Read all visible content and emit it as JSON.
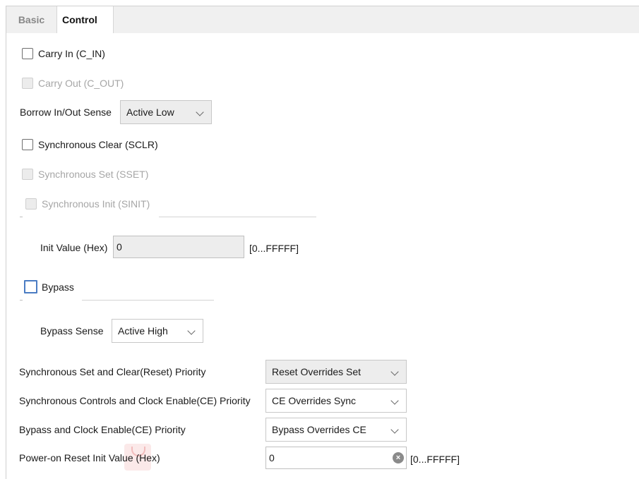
{
  "tabs": [
    {
      "label": "Basic",
      "active": false
    },
    {
      "label": "Control",
      "active": true
    }
  ],
  "carry_in": {
    "label": "Carry In (C_IN)",
    "checked": false,
    "enabled": true
  },
  "carry_out": {
    "label": "Carry Out (C_OUT)",
    "checked": false,
    "enabled": false
  },
  "borrow_sense": {
    "label": "Borrow In/Out Sense",
    "value": "Active Low"
  },
  "sclr": {
    "label": "Synchronous Clear (SCLR)",
    "checked": false,
    "enabled": true
  },
  "sset": {
    "label": "Synchronous Set (SSET)",
    "checked": false,
    "enabled": false
  },
  "sinit": {
    "label": "Synchronous Init (SINIT)",
    "checked": false,
    "enabled": false
  },
  "init_value": {
    "label": "Init Value (Hex)",
    "value": "0",
    "range": "[0...FFFFF]"
  },
  "bypass": {
    "label": "Bypass",
    "checked": false,
    "enabled": true
  },
  "bypass_sense": {
    "label": "Bypass Sense",
    "value": "Active High"
  },
  "set_clear_priority": {
    "label": "Synchronous Set and Clear(Reset) Priority",
    "value": "Reset Overrides Set"
  },
  "sync_ce_priority": {
    "label": "Synchronous Controls and Clock Enable(CE) Priority",
    "value": "CE Overrides Sync"
  },
  "bypass_ce_priority": {
    "label": "Bypass and Clock Enable(CE) Priority",
    "value": "Bypass Overrides CE"
  },
  "power_on_reset": {
    "label": "Power-on Reset Init Value (Hex)",
    "value": "0",
    "range": "[0...FFFFF]"
  },
  "icons": {
    "clear": "clear-circle-icon",
    "dropdown": "chevron-down-icon",
    "overlay": "bookmark-overlay-icon"
  }
}
